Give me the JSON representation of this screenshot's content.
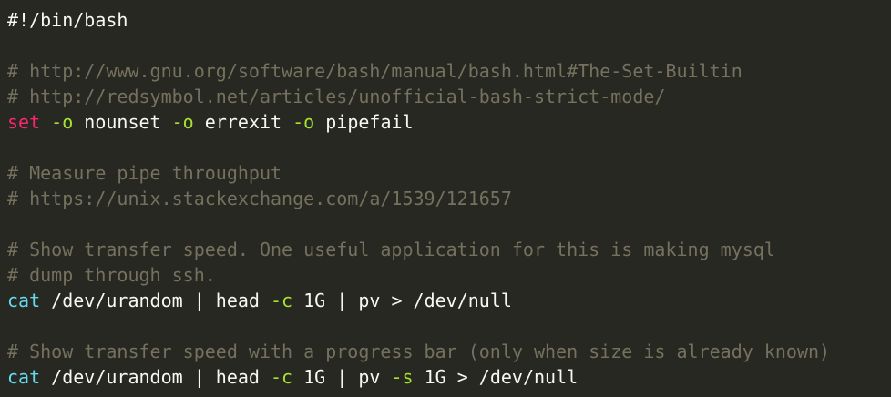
{
  "colors": {
    "background": "#272822",
    "default": "#f8f8f2",
    "comment": "#75715e",
    "keyword": "#f92672",
    "builtin": "#66d9ef",
    "flag": "#a6e22e"
  },
  "lines": [
    {
      "tokens": [
        {
          "text": "#!/bin/bash",
          "kind": "default"
        }
      ]
    },
    {
      "tokens": []
    },
    {
      "tokens": [
        {
          "text": "# http://www.gnu.org/software/bash/manual/bash.html#The-Set-Builtin",
          "kind": "comment"
        }
      ]
    },
    {
      "tokens": [
        {
          "text": "# http://redsymbol.net/articles/unofficial-bash-strict-mode/",
          "kind": "comment"
        }
      ]
    },
    {
      "tokens": [
        {
          "text": "set",
          "kind": "keyword"
        },
        {
          "text": " ",
          "kind": "default"
        },
        {
          "text": "-o",
          "kind": "flag"
        },
        {
          "text": " nounset ",
          "kind": "default"
        },
        {
          "text": "-o",
          "kind": "flag"
        },
        {
          "text": " errexit ",
          "kind": "default"
        },
        {
          "text": "-o",
          "kind": "flag"
        },
        {
          "text": " pipefail",
          "kind": "default"
        }
      ]
    },
    {
      "tokens": []
    },
    {
      "tokens": [
        {
          "text": "# Measure pipe throughput",
          "kind": "comment"
        }
      ]
    },
    {
      "tokens": [
        {
          "text": "# https://unix.stackexchange.com/a/1539/121657",
          "kind": "comment"
        }
      ]
    },
    {
      "tokens": []
    },
    {
      "tokens": [
        {
          "text": "# Show transfer speed. One useful application for this is making mysql",
          "kind": "comment"
        }
      ]
    },
    {
      "tokens": [
        {
          "text": "# dump through ssh.",
          "kind": "comment"
        }
      ]
    },
    {
      "tokens": [
        {
          "text": "cat",
          "kind": "builtin"
        },
        {
          "text": " /dev/urandom | head ",
          "kind": "default"
        },
        {
          "text": "-c",
          "kind": "flag"
        },
        {
          "text": " 1G | pv > /dev/null",
          "kind": "default"
        }
      ]
    },
    {
      "tokens": []
    },
    {
      "tokens": [
        {
          "text": "# Show transfer speed with a progress bar (only when size is already known)",
          "kind": "comment"
        }
      ]
    },
    {
      "tokens": [
        {
          "text": "cat",
          "kind": "builtin"
        },
        {
          "text": " /dev/urandom | head ",
          "kind": "default"
        },
        {
          "text": "-c",
          "kind": "flag"
        },
        {
          "text": " 1G | pv ",
          "kind": "default"
        },
        {
          "text": "-s",
          "kind": "flag"
        },
        {
          "text": " 1G > /dev/null",
          "kind": "default"
        }
      ]
    }
  ]
}
